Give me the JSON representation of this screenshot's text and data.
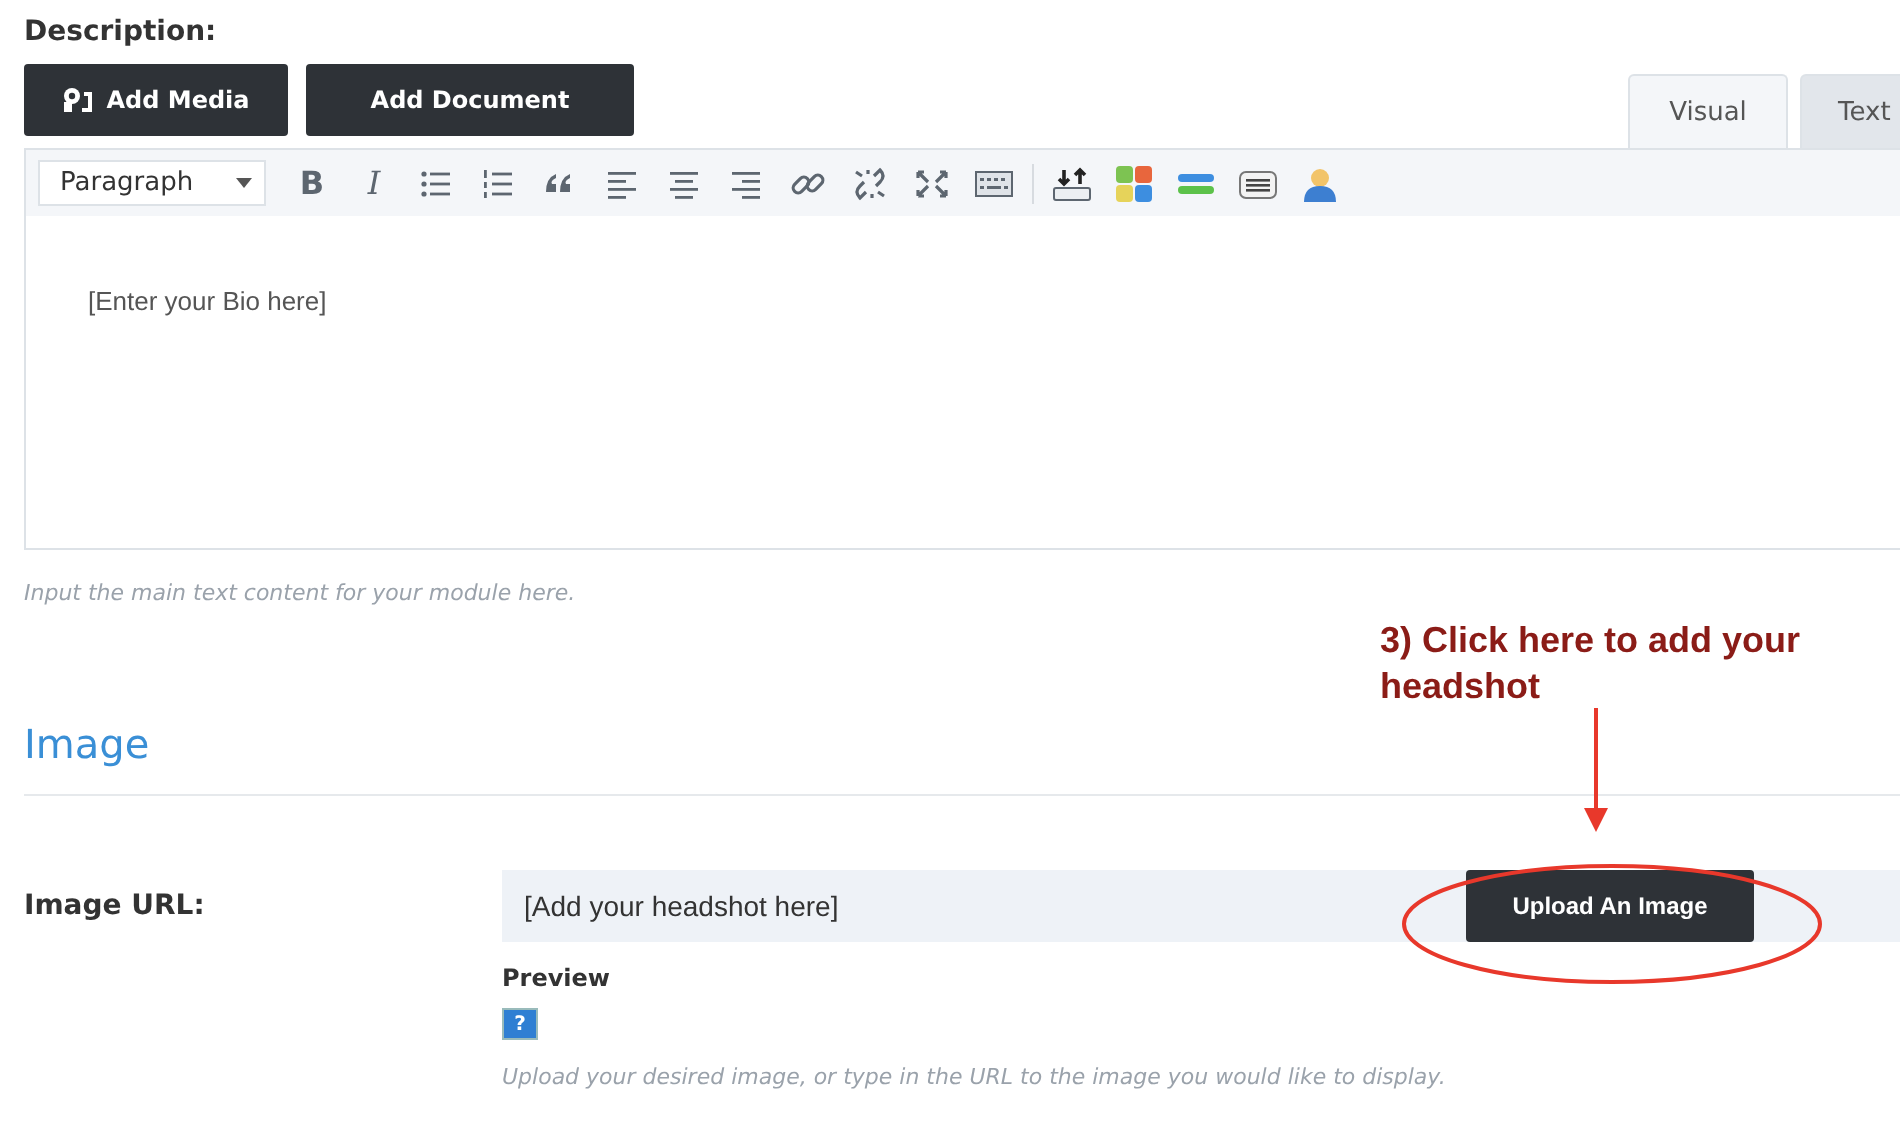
{
  "description_label": "Description:",
  "media_buttons": [
    {
      "kind": "media",
      "label": "Add Media"
    },
    {
      "kind": "plain",
      "label": "Add Document"
    }
  ],
  "editor_tabs": [
    {
      "label": "Visual",
      "selected": true
    },
    {
      "label": "Text",
      "selected": false
    }
  ],
  "toolbar": {
    "format_select": "Paragraph",
    "tools": [
      {
        "kind": "bold",
        "text": "B"
      },
      {
        "kind": "italic",
        "text": "I"
      },
      {
        "kind": "bullet-list"
      },
      {
        "kind": "number-list"
      },
      {
        "kind": "quote"
      },
      {
        "kind": "align-left"
      },
      {
        "kind": "align-center"
      },
      {
        "kind": "align-right"
      },
      {
        "kind": "link"
      },
      {
        "kind": "unlink"
      },
      {
        "kind": "fullscreen"
      },
      {
        "kind": "keyboard"
      },
      {
        "kind": "separator"
      },
      {
        "kind": "transfer"
      },
      {
        "kind": "tiles"
      },
      {
        "kind": "stripes"
      },
      {
        "kind": "lines"
      },
      {
        "kind": "person"
      }
    ]
  },
  "editor_content": "[Enter your Bio here]",
  "editor_hint": "Input the main text content for your module here.",
  "annotation": {
    "text": "3) Click here to add your headshot"
  },
  "image_section": {
    "heading": "Image",
    "url_label": "Image URL:",
    "url_value": "[Add your headshot here]",
    "upload_button": "Upload An Image",
    "preview_label": "Preview",
    "preview_icon": "?",
    "hint": "Upload your desired image, or type in the URL to the image you would like to display."
  }
}
